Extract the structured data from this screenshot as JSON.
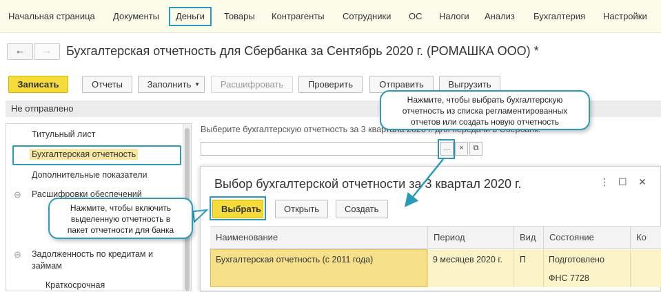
{
  "topmenu": {
    "items": [
      "Начальная страница",
      "Документы",
      "Деньги",
      "Товары",
      "Контрагенты",
      "Сотрудники",
      "ОС",
      "Налоги",
      "Анализ",
      "Бухгалтерия",
      "Настройки"
    ],
    "active": "Деньги"
  },
  "title": "Бухгалтерская отчетность для Сбербанка за Сентябрь 2020 г. (РОМАШКА ООО) *",
  "nav": {
    "back": "←",
    "forward": "→"
  },
  "toolbar": {
    "save": "Записать",
    "reports": "Отчеты",
    "fill": "Заполнить",
    "decode": "Расшифровать",
    "check": "Проверить",
    "send": "Отправить",
    "upload": "Выгрузить"
  },
  "status": "Не отправлено",
  "sections": {
    "items": [
      "Титульный лист",
      "Бухгалтерская отчетность",
      "Дополнительные показатели",
      "Расшифровки обеспечений",
      "Задолженность по кредитам и",
      "займам",
      "Краткосрочная"
    ]
  },
  "main": {
    "hint": "Выберите бухгалтерскую отчетность за 3 квартала 2020 г. для передачи в Сбербанк:",
    "field_value": "",
    "select_btn": "...",
    "clear_btn": "×",
    "open_btn": "⧉"
  },
  "dialog": {
    "title": "Выбор бухгалтерской отчетности за 3 квартал 2020 г.",
    "choose": "Выбрать",
    "open": "Открыть",
    "create": "Создать",
    "columns": [
      "Наименование",
      "Период",
      "Вид",
      "Состояние",
      "Ко"
    ],
    "rows": [
      {
        "name": "Бухгалтерская отчетность (с 2011 года)",
        "period": "9 месяцев 2020 г.",
        "kind": "П",
        "state": "Подготовлено",
        "state2": "ФНС 7728"
      }
    ]
  },
  "tooltips": {
    "tip1": [
      "Нажмите, чтобы выбрать бухгалтерскую",
      "отчетность из списка регламентированных",
      "отчетов или создать новую отчетность"
    ],
    "tip2": [
      "Нажмите, чтобы включить",
      "выделенную отчетность в",
      "пакет отчетности для банка"
    ]
  },
  "colors": {
    "accent": "#2a9ab8",
    "primary": "#f5dc3a",
    "selection": "#f8e7a3"
  }
}
